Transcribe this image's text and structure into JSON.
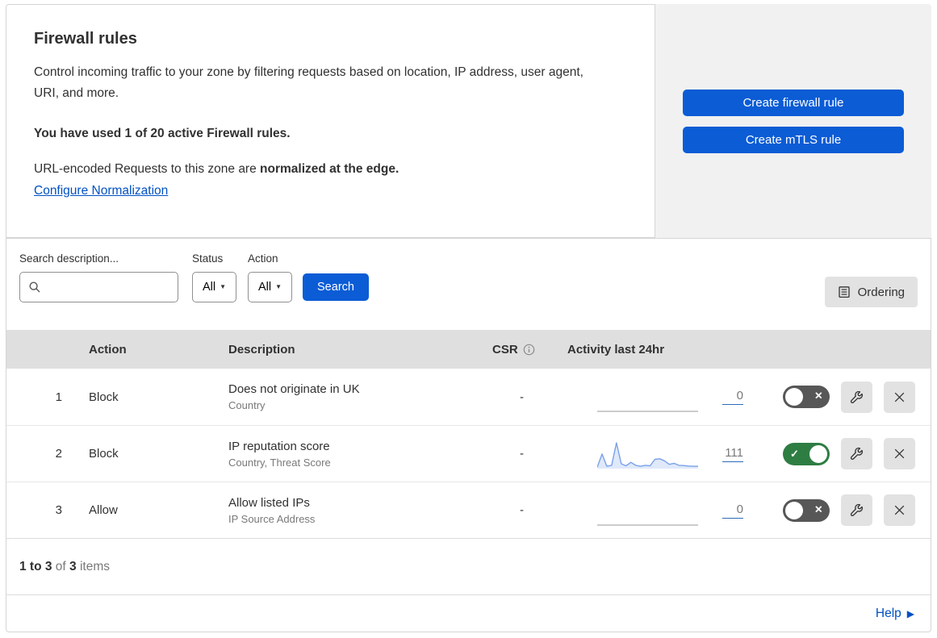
{
  "intro": {
    "title": "Firewall rules",
    "description": "Control incoming traffic to your zone by filtering requests based on location, IP address, user agent, URI, and more.",
    "usage": "You have used 1 of 20 active Firewall rules.",
    "norm_prefix": "URL-encoded Requests to this zone are ",
    "norm_bold": "normalized at the edge.",
    "norm_link": "Configure Normalization"
  },
  "cta": {
    "create_firewall": "Create firewall rule",
    "create_mtls": "Create mTLS rule"
  },
  "filters": {
    "search_label": "Search description...",
    "status_label": "Status",
    "status_value": "All",
    "action_label": "Action",
    "action_value": "All",
    "search_button": "Search",
    "ordering_button": "Ordering"
  },
  "table": {
    "headers": {
      "action": "Action",
      "description": "Description",
      "csr": "CSR",
      "activity": "Activity last 24hr"
    },
    "rows": [
      {
        "index": "1",
        "action": "Block",
        "description": "Does not originate in UK",
        "criteria": "Country",
        "csr": "-",
        "count": "0",
        "enabled": false
      },
      {
        "index": "2",
        "action": "Block",
        "description": "IP reputation score",
        "criteria": "Country, Threat Score",
        "csr": "-",
        "count": "111",
        "enabled": true
      },
      {
        "index": "3",
        "action": "Allow",
        "description": "Allow listed IPs",
        "criteria": "IP Source Address",
        "csr": "-",
        "count": "0",
        "enabled": false
      }
    ]
  },
  "footer": {
    "range": "1 to 3",
    "of": " of ",
    "total": "3",
    "items": " items"
  },
  "help": {
    "label": "Help"
  },
  "colors": {
    "primary_blue": "#0b5cd5",
    "link_blue": "#0051c3",
    "toggle_on_green": "#2e7d43",
    "toggle_off_gray": "#575757",
    "sparkline_stroke": "#7aa1e8",
    "sparkline_fill": "#dfe9fa",
    "flat_line_gray": "#adadad"
  },
  "chart_data": [
    {
      "type": "line",
      "name": "rule-1-activity-sparkline",
      "title": "Activity last 24hr — rule 1 (Does not originate in UK)",
      "xlabel": "",
      "ylabel": "",
      "total_shown": 0,
      "values_relative": [
        0,
        0,
        0,
        0,
        0,
        0,
        0,
        0,
        0,
        0,
        0,
        0,
        0,
        0,
        0,
        0,
        0,
        0,
        0,
        0,
        0,
        0
      ],
      "grid": false,
      "legend": false
    },
    {
      "type": "line",
      "name": "rule-2-activity-sparkline",
      "title": "Activity last 24hr — rule 2 (IP reputation score)",
      "xlabel": "",
      "ylabel": "",
      "total_shown": 111,
      "values_relative": [
        3,
        55,
        6,
        10,
        100,
        16,
        8,
        22,
        10,
        6,
        10,
        8,
        34,
        36,
        28,
        14,
        18,
        10,
        9,
        7,
        6,
        6
      ],
      "grid": false,
      "legend": false
    },
    {
      "type": "line",
      "name": "rule-3-activity-sparkline",
      "title": "Activity last 24hr — rule 3 (Allow listed IPs)",
      "xlabel": "",
      "ylabel": "",
      "total_shown": 0,
      "values_relative": [
        0,
        0,
        0,
        0,
        0,
        0,
        0,
        0,
        0,
        0,
        0,
        0,
        0,
        0,
        0,
        0,
        0,
        0,
        0,
        0,
        0,
        0
      ],
      "grid": false,
      "legend": false
    }
  ]
}
